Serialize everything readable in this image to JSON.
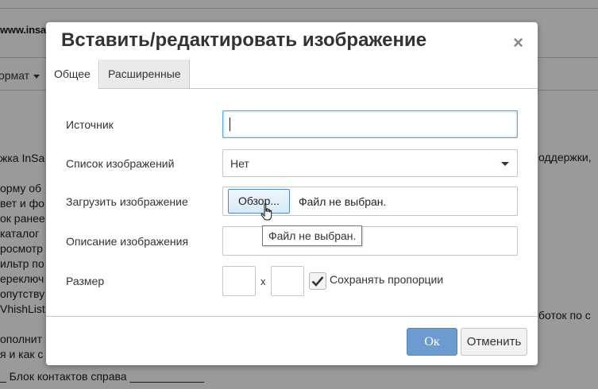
{
  "background": {
    "url_text": "www.insales",
    "format_menu": "ормат",
    "left_lines": [
      "жка InSa",
      "",
      "орму об",
      "вет и фо",
      "ок ранее",
      "каталог",
      "росмотр",
      "ильтр по",
      "ереключ",
      "опутству",
      "VhishList",
      "",
      "ополнит",
      "я и как с"
    ],
    "right_text_1": "оддержки,",
    "right_text_2": "боток по с",
    "bottom_text": "_  Блок контактов справа ____________"
  },
  "dialog": {
    "title": "Вставить/редактировать изображение",
    "close_label": "×",
    "tabs": [
      {
        "label": "Общее",
        "active": true
      },
      {
        "label": "Расширенные",
        "active": false
      }
    ],
    "fields": {
      "source_label": "Источник",
      "source_value": "",
      "image_list_label": "Список изображений",
      "image_list_value": "Нет",
      "upload_label": "Загрузить изображение",
      "browse_button": "Обзор...",
      "file_status": "Файл не выбран.",
      "tooltip": "Файл не выбран.",
      "description_label": "Описание изображения",
      "description_value": "",
      "size_label": "Размер",
      "width_value": "",
      "height_value": "",
      "size_separator": "x",
      "keep_proportions_label": "Сохранять пропорции",
      "keep_proportions_checked": true
    },
    "buttons": {
      "ok": "Ок",
      "cancel": "Отменить"
    }
  },
  "colors": {
    "accent": "#6b9bd1",
    "focus_border": "#59a5e5"
  }
}
